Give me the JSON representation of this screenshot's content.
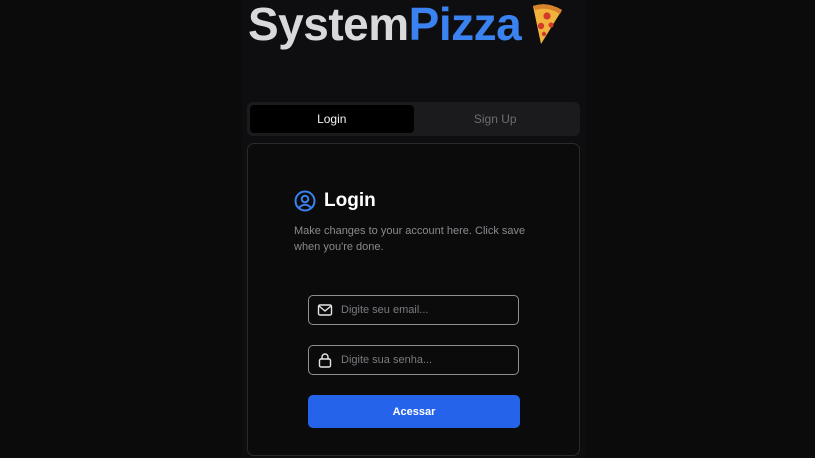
{
  "brand": {
    "part1": "System",
    "part2": "Pizza",
    "icon": "pizza-slice-icon",
    "colors": {
      "part1": "#d9d9db",
      "part2": "#3a82f0"
    }
  },
  "tabs": [
    {
      "label": "Login",
      "active": true
    },
    {
      "label": "Sign Up",
      "active": false
    }
  ],
  "card": {
    "icon": "user-circle-icon",
    "title": "Login",
    "description": "Make changes to your account here. Click save when you're done."
  },
  "form": {
    "email": {
      "icon": "mail-icon",
      "placeholder": "Digite seu email...",
      "value": ""
    },
    "password": {
      "icon": "lock-icon",
      "placeholder": "Digite sua senha...",
      "value": ""
    },
    "submit_label": "Acessar"
  },
  "colors": {
    "background": "#0b0b0c",
    "accent": "#2563eb"
  }
}
